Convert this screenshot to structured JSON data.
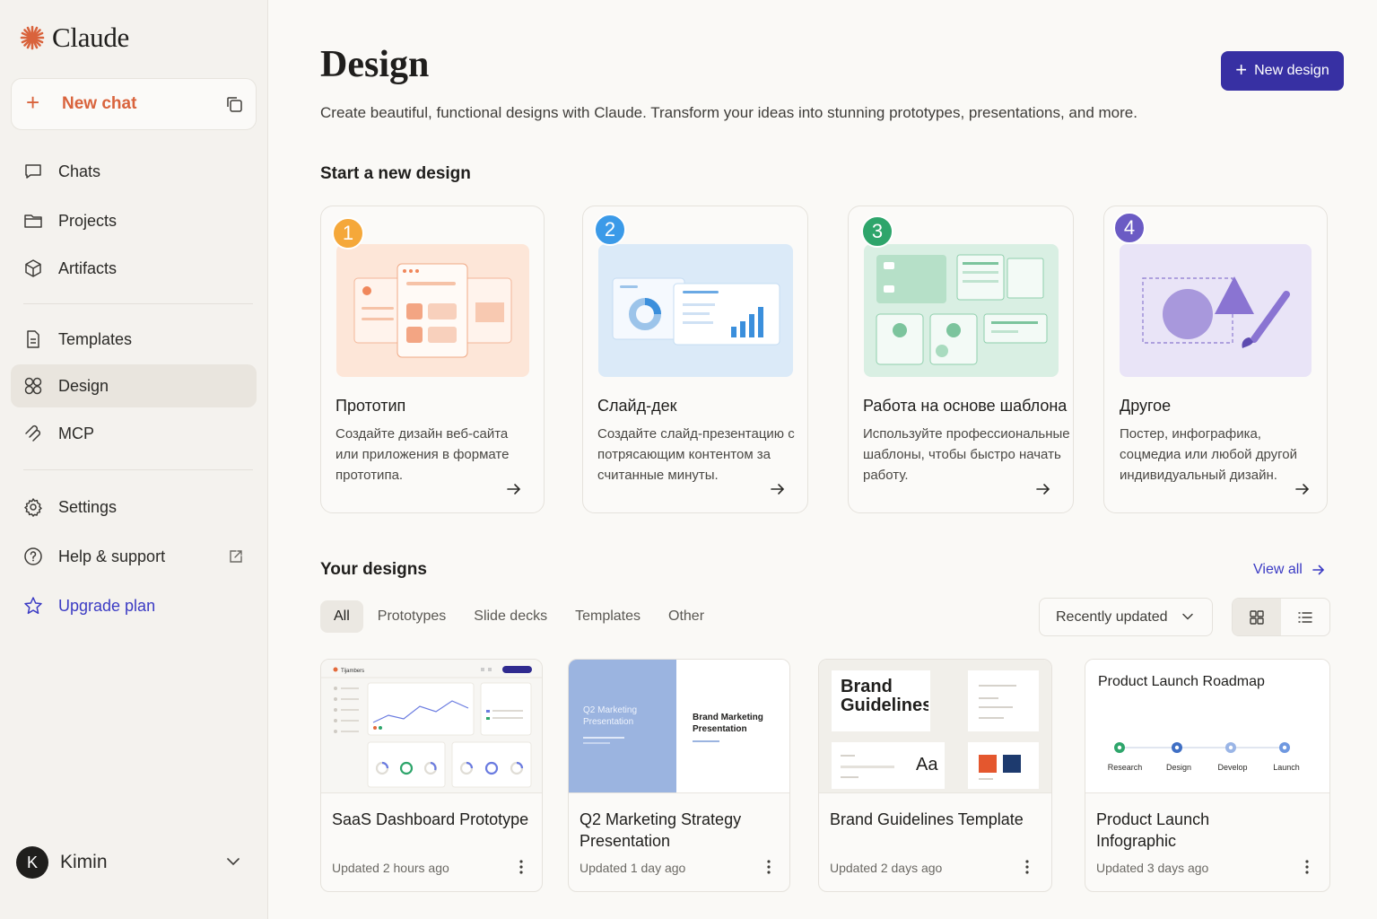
{
  "sidebar": {
    "brand": "Claude",
    "new_chat": "New chat",
    "items": [
      {
        "label": "Chats",
        "icon": "chat-bubble-icon"
      },
      {
        "label": "Projects",
        "icon": "folder-icon"
      },
      {
        "label": "Artifacts",
        "icon": "cube-icon"
      },
      {
        "label": "Templates",
        "icon": "document-icon"
      },
      {
        "label": "Design",
        "icon": "grid-circles-icon",
        "active": true
      },
      {
        "label": "MCP",
        "icon": "mcp-icon"
      },
      {
        "label": "Settings",
        "icon": "gear-icon"
      },
      {
        "label": "Help & support",
        "icon": "help-circle-icon"
      },
      {
        "label": "Upgrade plan",
        "icon": "star-icon"
      }
    ],
    "user": {
      "initial": "K",
      "name": "Kimin"
    }
  },
  "header": {
    "title": "Design",
    "subtitle": "Create beautiful, functional designs with Claude. Transform your ideas into stunning prototypes, presentations, and more.",
    "new_design": "New design"
  },
  "start": {
    "heading": "Start a new design",
    "cards": [
      {
        "num": "1",
        "title": "Прототип",
        "desc": "Создайте дизайн веб-сайта или приложения в формате прототипа.",
        "badge_color": "#f5a83a"
      },
      {
        "num": "2",
        "title": "Слайд-дек",
        "desc": "Создайте слайд-презентацию с потрясающим контентом за считанные минуты.",
        "badge_color": "#3b9ae8"
      },
      {
        "num": "3",
        "title": "Работа на основе шаблона",
        "desc": "Используйте профессиональные шаблоны, чтобы быстро начать работу.",
        "badge_color": "#2ea56b"
      },
      {
        "num": "4",
        "title": "Другое",
        "desc": "Постер, инфографика, соцмедиа или любой другой индивидуальный дизайн.",
        "badge_color": "#6b5bc4"
      }
    ]
  },
  "designs": {
    "heading": "Your designs",
    "view_all": "View all",
    "filters": [
      "All",
      "Prototypes",
      "Slide decks",
      "Templates",
      "Other"
    ],
    "sort": "Recently updated",
    "items": [
      {
        "title": "SaaS Dashboard Prototype",
        "updated": "Updated 2 hours ago"
      },
      {
        "title": "Q2 Marketing Strategy Presentation",
        "updated": "Updated 1 day ago"
      },
      {
        "title": "Brand Guidelines Template",
        "updated": "Updated 2 days ago"
      },
      {
        "title": "Product Launch Infographic",
        "updated": "Updated 3 days ago"
      }
    ],
    "thumbs": {
      "dashboard_brand": "Tijambers",
      "q2_left": "Q2 Marketing Presentation",
      "q2_right": "Brand Marketing Presentation",
      "brand_title": "Brand Guidelines",
      "brand_aa": "Aa",
      "roadmap_title": "Product Launch Roadmap",
      "roadmap_steps": [
        "Research",
        "Design",
        "Develop",
        "Launch"
      ]
    }
  }
}
